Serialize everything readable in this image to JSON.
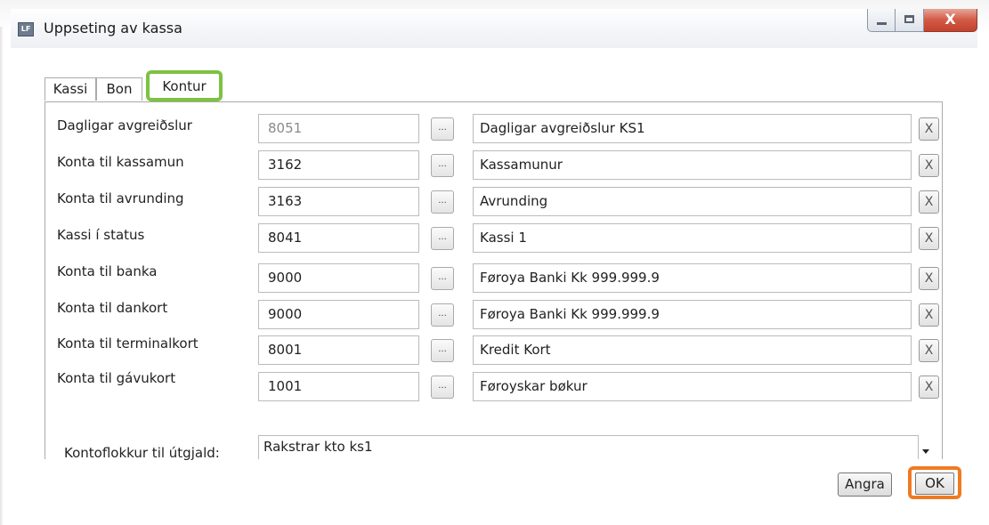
{
  "window": {
    "title": "Uppseting av kassa",
    "icon_label": "LF",
    "close_glyph": "X"
  },
  "tabs": [
    {
      "label": "Kassi"
    },
    {
      "label": "Bon"
    },
    {
      "label": "Kontur",
      "active": true
    }
  ],
  "accounts": [
    {
      "label": "Dagligar avgreiðslur",
      "number": "8051",
      "name": "Dagligar avgreiðslur KS1"
    },
    {
      "label": "Konta til kassamun",
      "number": "3162",
      "name": "Kassamunur"
    },
    {
      "label": "Konta til avrunding",
      "number": "3163",
      "name": "Avrunding"
    },
    {
      "label": "Kassi í status",
      "number": "8041",
      "name": "Kassi 1"
    },
    {
      "label": "Konta til banka",
      "number": "9000",
      "name": "Føroya Banki  Kk 999.999.9"
    },
    {
      "label": "Konta til dankort",
      "number": "9000",
      "name": "Føroya Banki  Kk 999.999.9"
    },
    {
      "label": "Konta til terminalkort",
      "number": "8001",
      "name": "Kredit Kort"
    },
    {
      "label": "Konta til gávukort",
      "number": "1001",
      "name": "Føroyskar bøkur"
    }
  ],
  "row_buttons": {
    "browse_label": "...",
    "clear_label": "X"
  },
  "kontoflokkur": {
    "label": "Kontoflokkur til útgjald:",
    "value": "Rakstrar kto ks1"
  },
  "footer": {
    "cancel_label": "Angra",
    "ok_label": "OK"
  },
  "highlight_colors": {
    "tab": "#7dc242",
    "ok": "#f07a22"
  }
}
